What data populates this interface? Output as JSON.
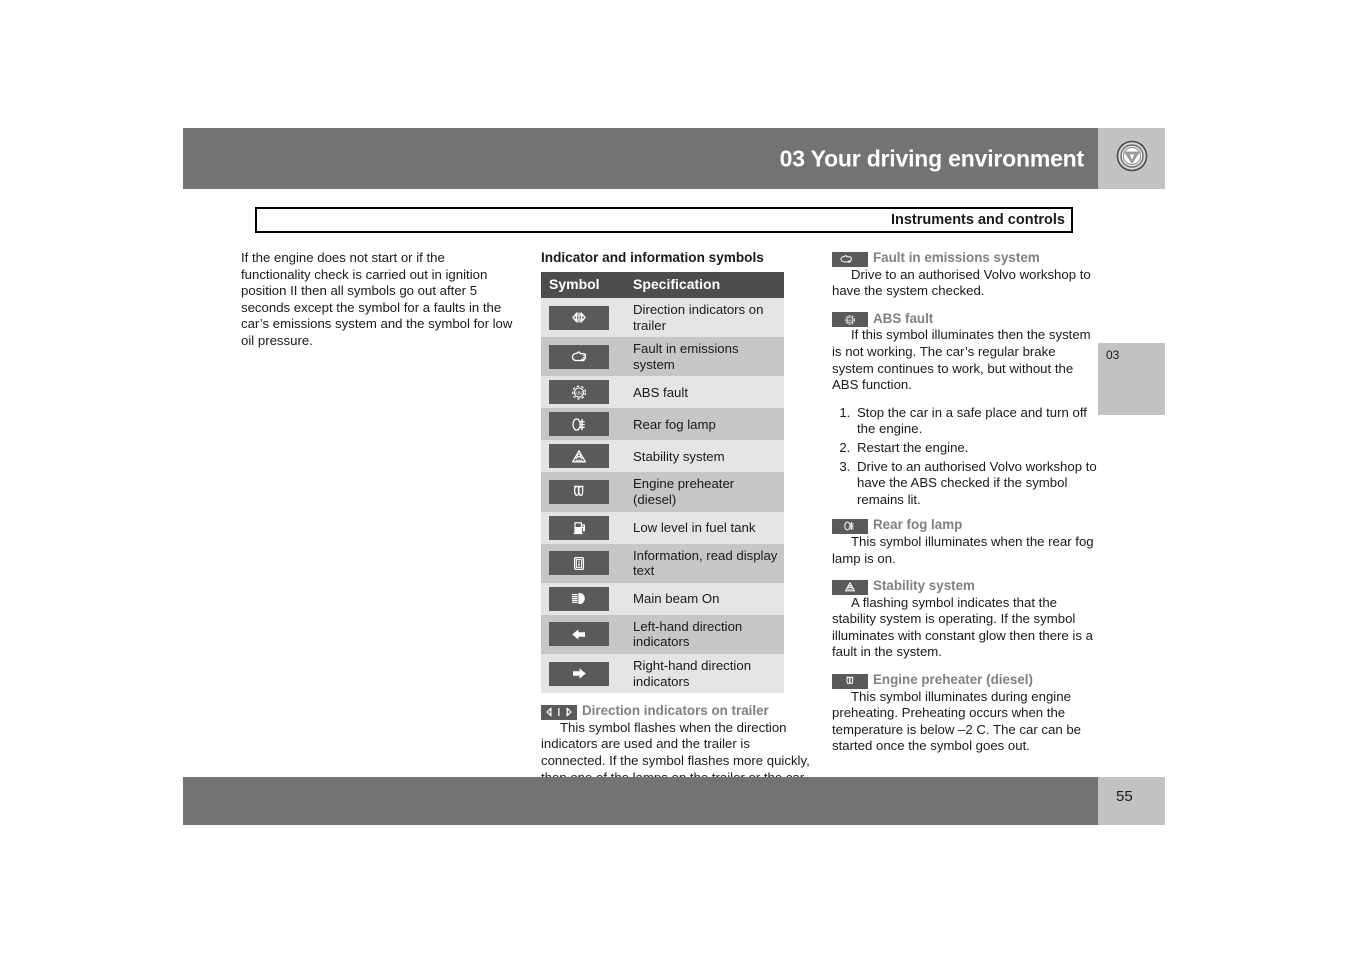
{
  "header": {
    "chapter_title": "03 Your driving environment",
    "logo": "volvo-emblem",
    "subtitle": "Instruments and controls"
  },
  "side_tab": {
    "chapter_number": "03"
  },
  "footer": {
    "page_number": "55"
  },
  "left_column": {
    "paragraph": "If the engine does not start or if the functionality check is carried out in ignition position II then all symbols go out after 5 seconds except the symbol for a faults in the car’s emissions system and the symbol for low oil pressure."
  },
  "middle_column": {
    "heading": "Indicator and information symbols",
    "table": {
      "columns": [
        "Symbol",
        "Specification"
      ],
      "rows": [
        {
          "icon": "direction-indicators-trailer-icon",
          "spec": "Direction indicators on trailer"
        },
        {
          "icon": "emissions-fault-icon",
          "spec": "Fault in emissions system"
        },
        {
          "icon": "abs-fault-icon",
          "spec": "ABS fault"
        },
        {
          "icon": "rear-fog-lamp-icon",
          "spec": "Rear fog lamp"
        },
        {
          "icon": "stability-system-icon",
          "spec": "Stability system"
        },
        {
          "icon": "engine-preheater-icon",
          "spec": "Engine preheater (diesel)"
        },
        {
          "icon": "low-fuel-icon",
          "spec": "Low level in fuel tank"
        },
        {
          "icon": "information-icon",
          "spec": "Information, read display text"
        },
        {
          "icon": "main-beam-icon",
          "spec": "Main beam On"
        },
        {
          "icon": "left-arrow-icon",
          "spec": "Left-hand direction indicators"
        },
        {
          "icon": "right-arrow-icon",
          "spec": "Right-hand direction indicators"
        }
      ]
    },
    "note": {
      "icon": "direction-indicators-trailer-icon",
      "title": "Direction indicators on trailer",
      "body": "This symbol flashes when the direction indicators are used and the trailer is connected. If the symbol flashes more quickly, then one of the lamps on the trailer or the car is faulty."
    }
  },
  "right_column": {
    "emissions": {
      "icon": "emissions-fault-icon",
      "title": "Fault in emissions system",
      "body": "Drive to an authorised Volvo workshop to have the system checked."
    },
    "abs": {
      "icon": "abs-fault-icon",
      "title": "ABS fault",
      "body": "If this symbol illuminates then the system is not working. The car’s regular brake system continues to work, but without the ABS function.",
      "steps": [
        "Stop the car in a safe place and turn off the engine.",
        "Restart the engine.",
        "Drive to an authorised Volvo workshop to have the ABS checked if the symbol remains lit."
      ]
    },
    "rear_fog": {
      "icon": "rear-fog-lamp-icon",
      "title": "Rear fog lamp",
      "body": "This symbol illuminates when the rear fog lamp is on."
    },
    "stability": {
      "icon": "stability-system-icon",
      "title": "Stability system",
      "body": "A flashing symbol indicates that the stability system is operating. If the symbol illuminates with constant glow then there is a fault in the system."
    },
    "preheater": {
      "icon": "engine-preheater-icon",
      "title": "Engine preheater (diesel)",
      "body": "This symbol illuminates during engine preheating. Preheating occurs when the temperature is below –2  C. The car can be started once the symbol goes out."
    }
  },
  "colors": {
    "band_gray": "#737373",
    "tab_gray": "#c2c2c2",
    "table_header": "#4d4d4d",
    "row_light": "#e4e4e4",
    "row_dark": "#c6c6c6",
    "chip_gray": "#5a5a5a",
    "subhead_gray": "#808080"
  }
}
